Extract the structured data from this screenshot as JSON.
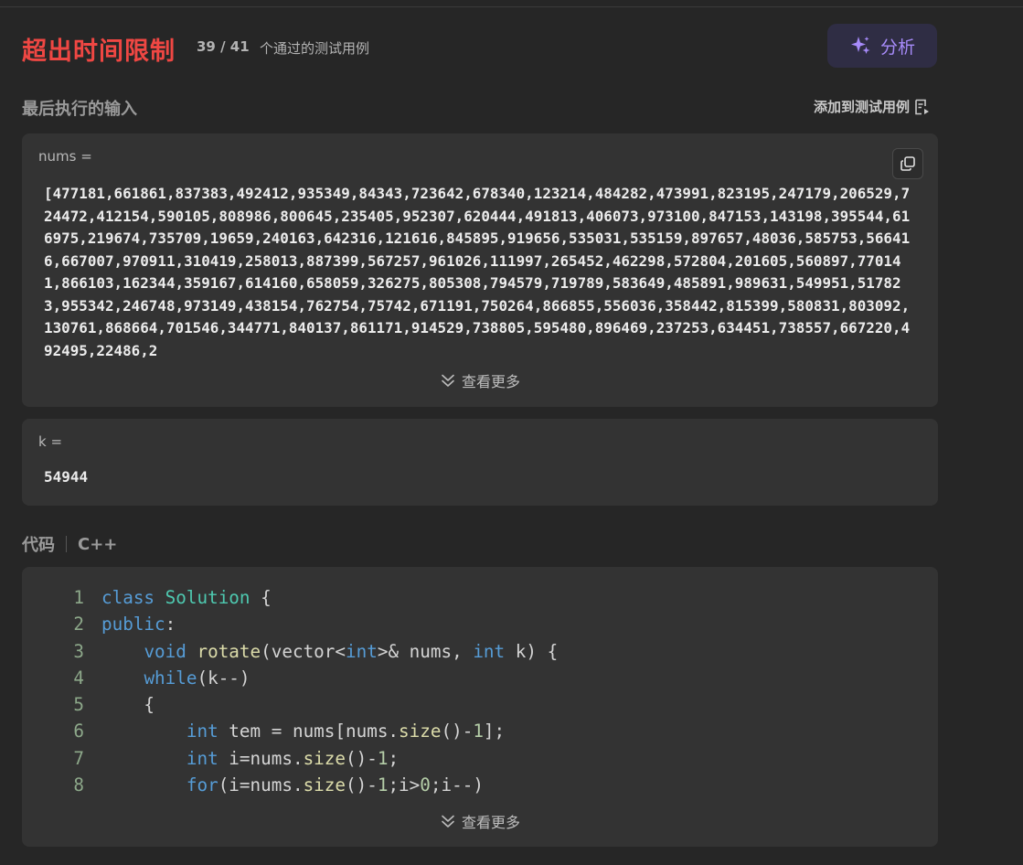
{
  "result": {
    "status": "超出时间限制",
    "passed": "39 / 41",
    "passed_label": "个通过的测试用例",
    "analyze_label": "分析"
  },
  "last_input": {
    "title": "最后执行的输入",
    "add_to_cases": "添加到测试用例",
    "nums_label": "nums =",
    "nums_value": "[477181,661861,837383,492412,935349,84343,723642,678340,123214,484282,473991,823195,247179,206529,724472,412154,590105,808986,800645,235405,952307,620444,491813,406073,973100,847153,143198,395544,616975,219674,735709,19659,240163,642316,121616,845895,919656,535031,535159,897657,48036,585753,566416,667007,970911,310419,258013,887399,567257,961026,111997,265452,462298,572804,201605,560897,770141,866103,162344,359167,614160,658059,326275,805308,794579,719789,583649,485891,989631,549951,517823,955342,246748,973149,438154,762754,75742,671191,750264,866855,556036,358442,815399,580831,803092,130761,868664,701546,344771,840137,861171,914529,738805,595480,896469,237253,634451,738557,667220,492495,22486,2",
    "see_more": "查看更多",
    "k_label": "k =",
    "k_value": "54944"
  },
  "code": {
    "title": "代码",
    "language": "C++",
    "see_more": "查看更多",
    "line_numbers": [
      "1",
      "2",
      "3",
      "4",
      "5",
      "6",
      "7",
      "8"
    ],
    "lines": {
      "l1": [
        "class",
        " ",
        "Solution",
        " {"
      ],
      "l2": [
        "public",
        ":"
      ],
      "l3": [
        "    ",
        "void",
        " ",
        "rotate",
        "(vector<",
        "int",
        ">& nums, ",
        "int",
        " k) {"
      ],
      "l4": [
        "    ",
        "while",
        "(k--)"
      ],
      "l5": [
        "    {"
      ],
      "l6": [
        "        ",
        "int",
        " tem = nums[nums.",
        "size",
        "()-",
        "1",
        "];"
      ],
      "l7": [
        "        ",
        "int",
        " i=nums.",
        "size",
        "()-",
        "1",
        ";"
      ],
      "l8": [
        "        ",
        "for",
        "(i=nums.",
        "size",
        "()-",
        "1",
        ";i>",
        "0",
        ";i--)"
      ]
    }
  },
  "icons": {
    "analyze": "sparkles-icon",
    "add_case": "add-testcase-icon",
    "copy": "copy-icon",
    "see_more": "double-chevron-down-icon"
  },
  "colors": {
    "background": "#262626",
    "card": "#333333",
    "error": "#ef4743",
    "accent_purple": "#a78bfa",
    "keyword": "#569cd6",
    "class_name": "#4ec9b0",
    "function": "#dcdcaa",
    "number": "#b5cea8"
  }
}
